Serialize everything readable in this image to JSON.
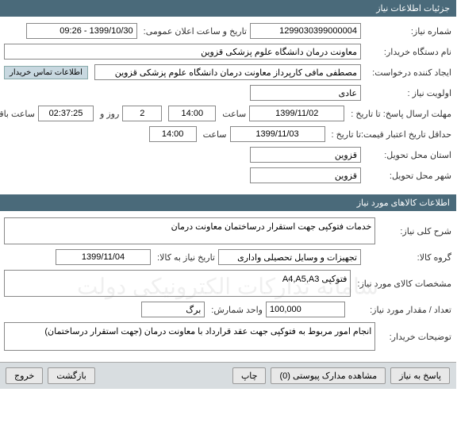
{
  "section1": {
    "title": "جزئیات اطلاعات نیاز",
    "labels": {
      "need_number": "شماره نیاز:",
      "announce_datetime": "تاریخ و ساعت اعلان عمومی:",
      "buyer_org": "نام دستگاه خریدار:",
      "creator": "ایجاد کننده درخواست:",
      "priority": "اولویت نیاز :",
      "response_deadline": "مهلت ارسال پاسخ:  تا تاریخ :",
      "hour_lbl": "ساعت",
      "days_and": "روز و",
      "remaining": "ساعت باقی مانده",
      "min_valid_date": "حداقل تاریخ اعتبار قیمت:",
      "to_date": "تا تاریخ :",
      "delivery_province": "استان محل تحویل:",
      "delivery_city": "شهر محل تحویل:",
      "contact_link": "اطلاعات تماس خریدار"
    },
    "values": {
      "need_number": "1299030399000004",
      "announce_datetime": "1399/10/30 - 09:26",
      "buyer_org": "معاونت درمان دانشگاه علوم پزشکی قزوین",
      "creator": "مصطفی مافی کارپرداز معاونت درمان دانشگاه علوم پزشکی قزوین",
      "priority": "عادی",
      "resp_date": "1399/11/02",
      "resp_time": "14:00",
      "days_remaining": "2",
      "time_remaining": "02:37:25",
      "valid_date": "1399/11/03",
      "valid_time": "14:00",
      "province": "قزوین",
      "city": "قزوین"
    }
  },
  "section2": {
    "title": "اطلاعات کالاهای مورد نیاز",
    "labels": {
      "general_desc": "شرح کلی نیاز:",
      "goods_group": "گروه کالا:",
      "need_date_lbl": "تاریخ نیاز به کالا:",
      "goods_spec": "مشخصات کالای مورد نیاز:",
      "quantity": "تعداد / مقدار مورد نیاز:",
      "unit": "واحد شمارش:",
      "buyer_notes": "توضیحات خریدار:"
    },
    "values": {
      "general_desc": "خدمات فتوکپی جهت استقرار درساختمان معاونت درمان",
      "goods_group": "تجهیزات و وسایل تحصیلی واداری",
      "need_date": "1399/11/04",
      "goods_spec": "فتوکپی A4,A5,A3",
      "quantity": "100,000",
      "unit": "برگ",
      "buyer_notes": "انجام امور مربوط به فتوکپی جهت عقد قرارداد با معاونت درمان (جهت استقرار درساختمان)"
    }
  },
  "footer": {
    "respond": "پاسخ به نیاز",
    "attachments": "مشاهده مدارک پیوستی (0)",
    "print": "چاپ",
    "back": "بازگشت",
    "exit": "خروج"
  },
  "watermark": "سامانه تدارکات الکترونیکی دولت"
}
